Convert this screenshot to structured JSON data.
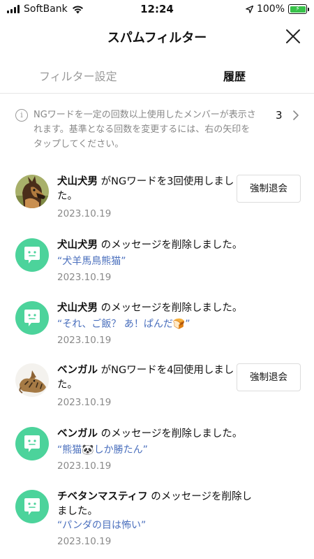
{
  "status_bar": {
    "carrier": "SoftBank",
    "time": "12:24",
    "battery": "100%",
    "battery_color": "#38c24a",
    "icons": [
      "signal-icon",
      "wifi-icon",
      "location-arrow-icon",
      "battery-charging-icon"
    ]
  },
  "header": {
    "title": "スパムフィルター",
    "close_icon": "close-icon"
  },
  "tabs": [
    {
      "label": "フィルター設定",
      "active": false
    },
    {
      "label": "履歴",
      "active": true
    }
  ],
  "info": {
    "text": "NGワードを一定の回数以上使用したメンバーが表示されます。基準となる回数を変更するには、右の矢印をタップしてください。",
    "count": "3",
    "icon": "info-icon",
    "arrow_icon": "chevron-right-icon"
  },
  "colors": {
    "bot_avatar": "#4cd39b",
    "quote_text": "#4a6fbd",
    "muted_text": "#8a8a8a"
  },
  "history": [
    {
      "avatar": "dog-photo",
      "name": "犬山犬男",
      "message_line1": " がNGワードを3回使用しまし",
      "message_line2": "た。",
      "date": "2023.10.19",
      "button": "強制退会"
    },
    {
      "avatar": "bot-icon",
      "name": "犬山犬男",
      "message_line1": " のメッセージを削除しました。",
      "quote": "“犬羊馬鳥熊猫”",
      "date": "2023.10.19"
    },
    {
      "avatar": "bot-icon",
      "name": "犬山犬男",
      "message_line1": " のメッセージを削除しました。",
      "quote": "“それ、ご飯？ あ！ぱんだ🍞”",
      "date": "2023.10.19"
    },
    {
      "avatar": "cat-photo",
      "name": "ベンガル",
      "message_line1": " がNGワードを4回使用しまし",
      "message_line2": "た。",
      "date": "2023.10.19",
      "button": "強制退会"
    },
    {
      "avatar": "bot-icon",
      "name": "ベンガル",
      "message_line1": " のメッセージを削除しました。",
      "quote": "“熊猫🐼しか勝たん”",
      "date": "2023.10.19"
    },
    {
      "avatar": "bot-icon",
      "name": "チベタンマスティフ",
      "message_line1": " のメッセージを削除し",
      "message_line2": "ました。",
      "quote": "“パンダの目は怖い”",
      "date": "2023.10.19"
    }
  ]
}
